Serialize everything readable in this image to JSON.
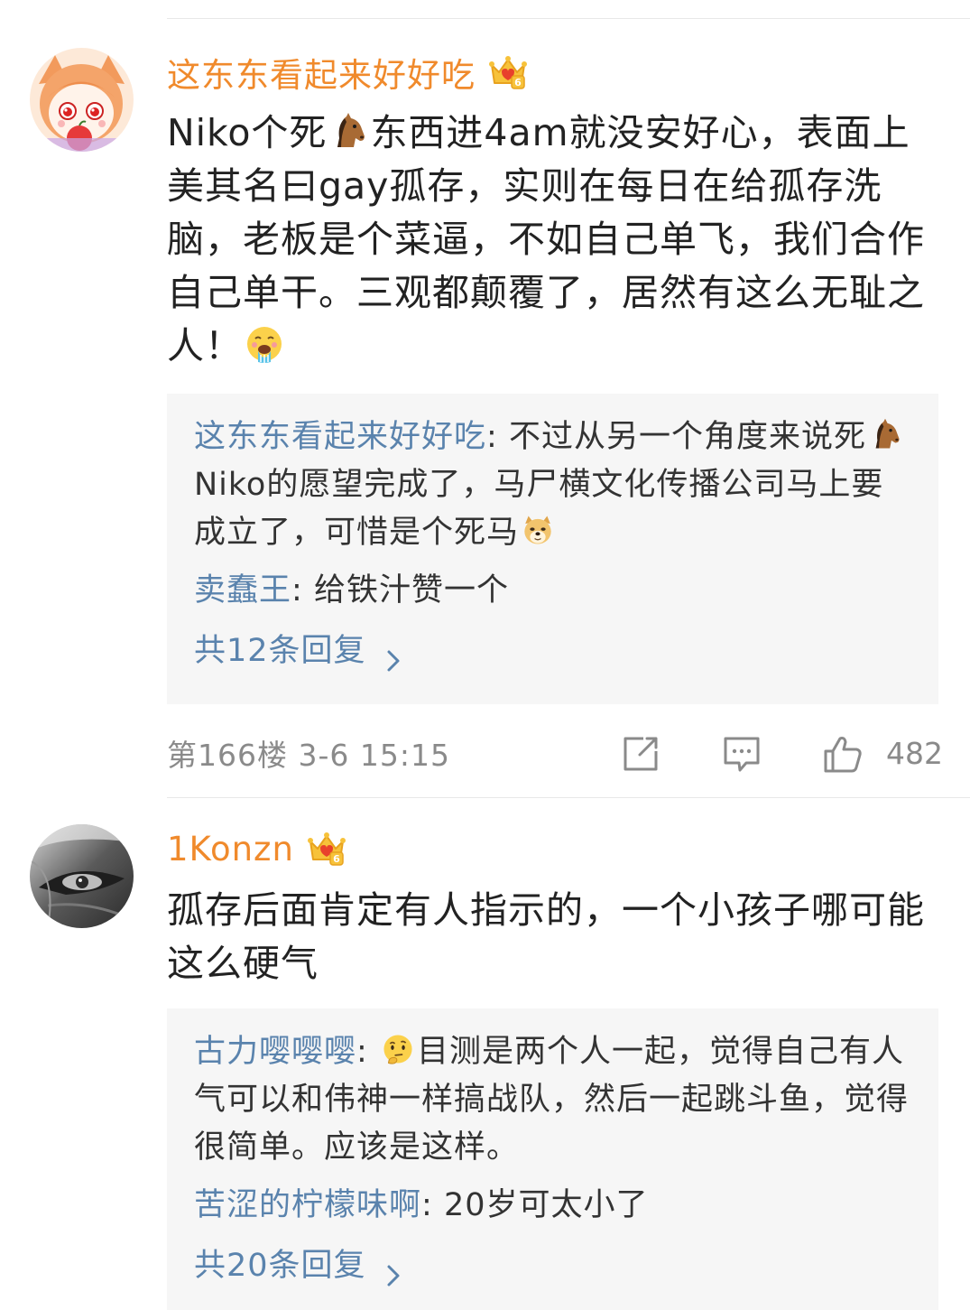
{
  "comments": [
    {
      "username": "这东东看起来好好吃",
      "content": {
        "part1": "Niko个死",
        "part2": "东西进4am就没安好心，表面上美其名曰gay孤存，实则在每日在给孤存洗脑，老板是个菜逼，不如自己单飞，我们合作自己单干。三观都颠覆了，居然有这么无耻之人！"
      },
      "replies": [
        {
          "user": "这东东看起来好好吃",
          "sep": ": ",
          "text_part1": "不过从另一个角度来说死",
          "text_part2": "Niko的愿望完成了，马尸横文化传播公司马上要成立了，可惜是个死马"
        },
        {
          "user": "卖蠢王",
          "sep": ": ",
          "text": "给铁汁赞一个"
        }
      ],
      "more_replies": "共12条回复",
      "meta": "第166楼 3-6 15:15",
      "like_count": "482"
    },
    {
      "username": "1Konzn",
      "content": "孤存后面肯定有人指示的，一个小孩子哪可能这么硬气",
      "replies": [
        {
          "user": "古力嘤嘤嘤",
          "sep": ": ",
          "text": "目测是两个人一起，觉得自己有人气可以和伟神一样搞战队，然后一起跳斗鱼，觉得很简单。应该是这样。"
        },
        {
          "user": "苦涩的柠檬味啊",
          "sep": ": ",
          "text": "20岁可太小了"
        }
      ],
      "more_replies": "共20条回复"
    }
  ],
  "icons": {
    "crown": "crown-vip-icon",
    "horse": "horse-emoji-icon",
    "vomit": "vomit-emoji-icon",
    "doge": "doge-emoji-icon",
    "thinking": "thinking-emoji-icon",
    "share": "share-icon",
    "comment": "comment-icon",
    "like": "thumbs-up-icon",
    "chevron": "chevron-right-icon"
  },
  "colors": {
    "username": "#f08a2c",
    "reply_user": "#5a83ad",
    "meta": "#8a8a8a",
    "reply_bg": "#f6f6f6"
  }
}
